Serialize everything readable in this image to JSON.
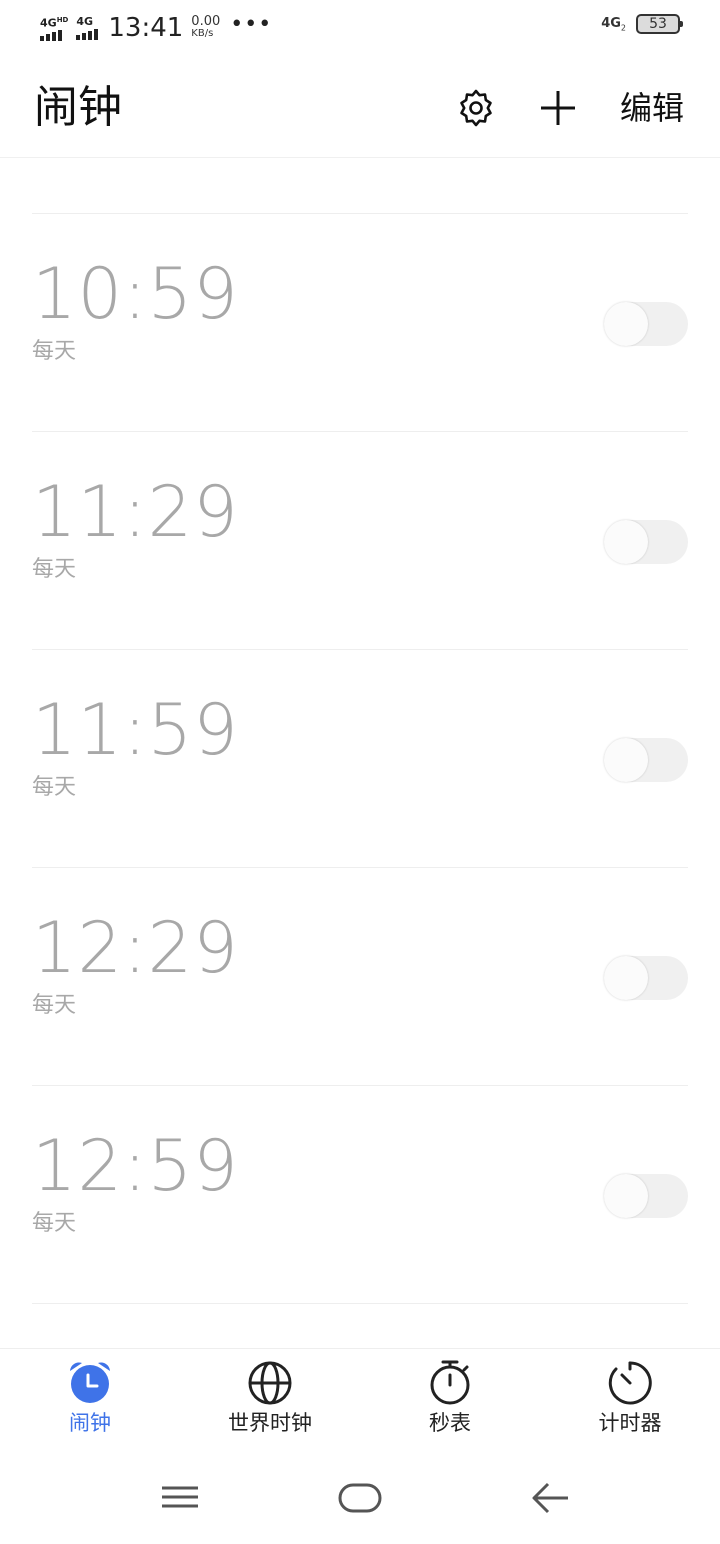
{
  "status_bar": {
    "sim1_label": "4G",
    "sim1_sup": "HD",
    "sim2_label": "4G",
    "time": "13:41",
    "speed_value": "0.00",
    "speed_unit": "KB/s",
    "more": "•••",
    "right_network": "4G",
    "right_network_sub": "2",
    "battery": "53"
  },
  "header": {
    "title": "闹钟",
    "edit_label": "编辑",
    "settings_icon": "gear-icon",
    "add_icon": "plus-icon"
  },
  "alarms": [
    {
      "time": "10:59",
      "repeat": "每天",
      "enabled": false
    },
    {
      "time": "11:29",
      "repeat": "每天",
      "enabled": false
    },
    {
      "time": "11:59",
      "repeat": "每天",
      "enabled": false
    },
    {
      "time": "12:29",
      "repeat": "每天",
      "enabled": false
    },
    {
      "time": "12:59",
      "repeat": "每天",
      "enabled": false
    }
  ],
  "bottom_nav": {
    "items": [
      {
        "label": "闹钟",
        "icon": "alarm-clock-icon",
        "active": true
      },
      {
        "label": "世界时钟",
        "icon": "globe-icon",
        "active": false
      },
      {
        "label": "秒表",
        "icon": "stopwatch-icon",
        "active": false
      },
      {
        "label": "计时器",
        "icon": "timer-icon",
        "active": false
      }
    ]
  },
  "colors": {
    "accent": "#3f73e8",
    "alarm_text_disabled": "#a8a8a8",
    "toggle_off": "#f0f0f0"
  }
}
